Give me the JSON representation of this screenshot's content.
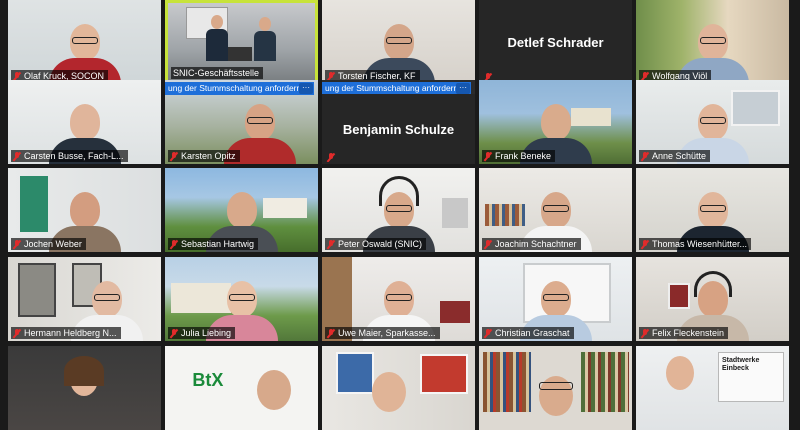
{
  "banner_text": "ung der Stummschaltung anfordern",
  "banner_more": "···",
  "tiles": [
    {
      "label": "Olaf Kruck, SOCON"
    },
    {
      "label": "SNIC-Geschäftsstelle"
    },
    {
      "label": "Torsten Fischer, KF"
    },
    {
      "label": "",
      "name_only": "Detlef Schrader"
    },
    {
      "label": "Wolfgang Viöl"
    },
    {
      "label": "Carsten Busse, Fach-L..."
    },
    {
      "label": "Karsten Opitz"
    },
    {
      "label": "",
      "name_only": "Benjamin Schulze"
    },
    {
      "label": "Frank Beneke"
    },
    {
      "label": "Anne Schütte"
    },
    {
      "label": "Jochen Weber"
    },
    {
      "label": "Sebastian Hartwig"
    },
    {
      "label": "Peter Oswald (SNIC)"
    },
    {
      "label": "Joachim Schachtner"
    },
    {
      "label": "Thomas Wiesenhütter..."
    },
    {
      "label": "Hermann Heldberg N..."
    },
    {
      "label": "Julia Liebing"
    },
    {
      "label": "Uwe Maier, Sparkasse..."
    },
    {
      "label": "Christian Graschat"
    },
    {
      "label": "Felix Fleckenstein"
    },
    {
      "label": ""
    },
    {
      "label": "",
      "logo": "BtX"
    },
    {
      "label": ""
    },
    {
      "label": ""
    },
    {
      "label": "",
      "sign": "Stadtwerke Einbeck"
    }
  ]
}
